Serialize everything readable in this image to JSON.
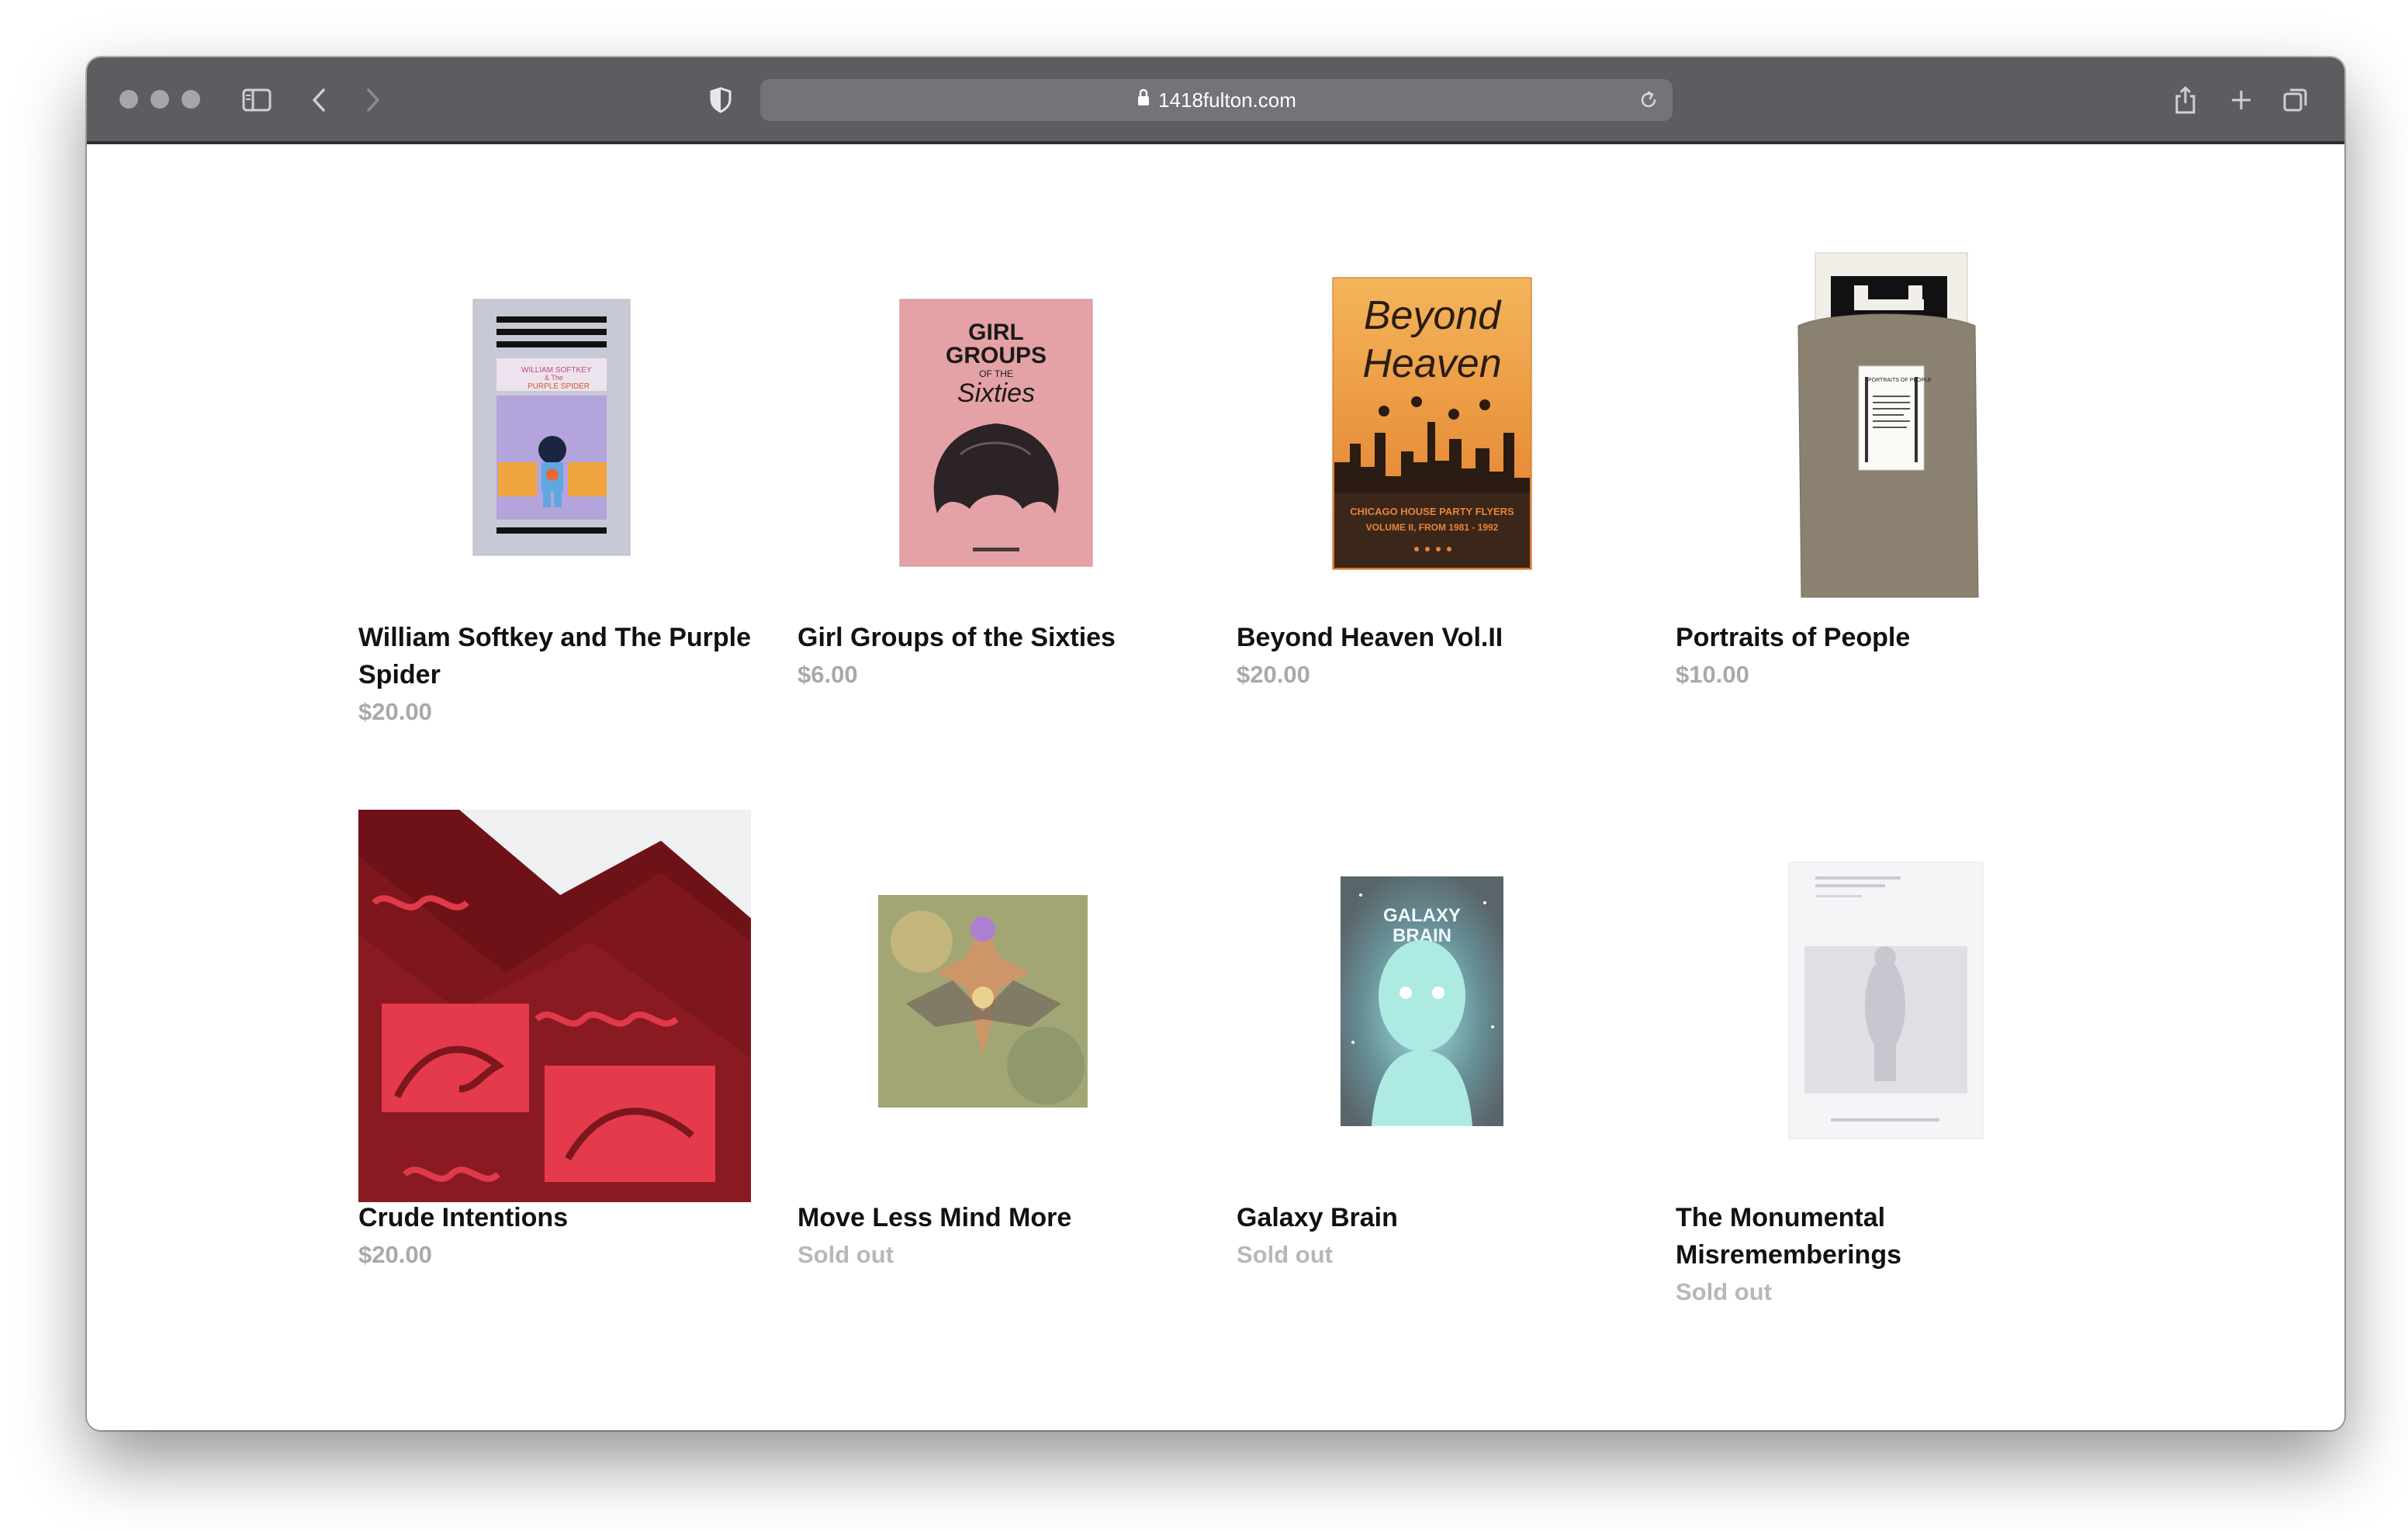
{
  "browser": {
    "url": "1418fulton.com",
    "icons": [
      "sidebar-icon",
      "back-icon",
      "forward-icon",
      "shield-icon",
      "lock-icon",
      "reload-icon",
      "share-icon",
      "new-tab-icon",
      "tabs-overview-icon"
    ]
  },
  "products": [
    {
      "title": "William Softkey and The Purple Spider",
      "price": "$20.00",
      "cover_text": [
        "WILLIAM SOFTKEY",
        "& The",
        "PURPLE SPIDER"
      ]
    },
    {
      "title": "Girl Groups of the Sixties",
      "price": "$6.00",
      "cover_text": [
        "GIRL",
        "GROUPS",
        "OF THE",
        "Sixties"
      ]
    },
    {
      "title": "Beyond Heaven Vol.II",
      "price": "$20.00",
      "cover_text": [
        "Beyond",
        "Heaven",
        "CHICAGO HOUSE PARTY FLYERS",
        "VOLUME II, FROM 1981 - 1992"
      ]
    },
    {
      "title": "Portraits of People",
      "price": "$10.00",
      "cover_text": [
        "PORTRAITS",
        "OF PEOPLE"
      ]
    },
    {
      "title": "Crude Intentions",
      "price": "$20.00"
    },
    {
      "title": "Move Less Mind More",
      "price": "Sold out"
    },
    {
      "title": "Galaxy Brain",
      "price": "Sold out",
      "cover_text": [
        "GALAXY",
        "BRAIN"
      ]
    },
    {
      "title": "The Monumental Misrememberings",
      "price": "Sold out"
    }
  ]
}
